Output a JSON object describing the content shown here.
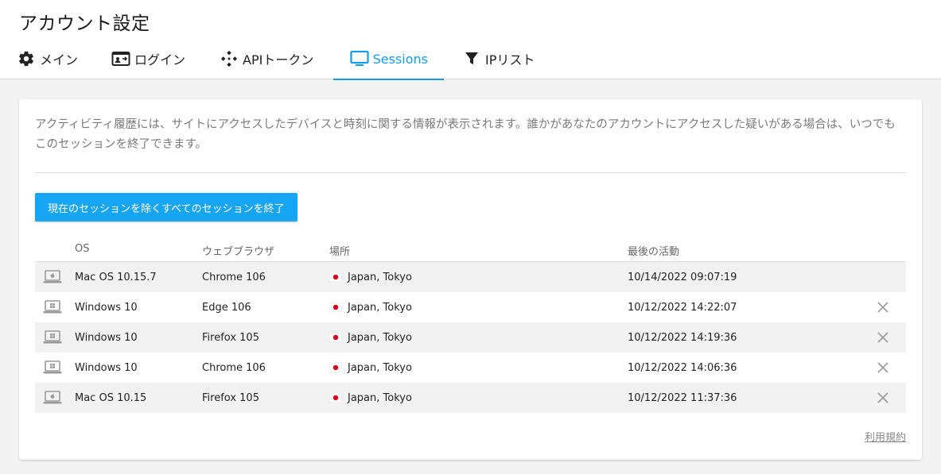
{
  "page": {
    "title": "アカウント設定"
  },
  "tabs": [
    {
      "label": "メイン",
      "icon": "gear-icon"
    },
    {
      "label": "ログイン",
      "icon": "id-card-icon"
    },
    {
      "label": "APIトークン",
      "icon": "api-icon"
    },
    {
      "label": "Sessions",
      "icon": "monitor-icon",
      "active": true
    },
    {
      "label": "IPリスト",
      "icon": "filter-icon"
    }
  ],
  "colors": {
    "accent": "#1a9ae6",
    "button": "#16a5f2",
    "row_shade": "#f2f2f2"
  },
  "sessions": {
    "description": "アクティビティ履歴には、サイトにアクセスしたデバイスと時刻に関する情報が表示されます。誰かがあなたのアカウントにアクセスした疑いがある場合は、いつでもこのセッションを終了できます。",
    "end_all_label": "現在のセッションを除くすべてのセッションを終了",
    "columns": {
      "os": "OS",
      "browser": "ウェブブラウザ",
      "location": "場所",
      "last_activity": "最後の活動"
    },
    "rows": [
      {
        "device_icon": "apple-laptop-icon",
        "os": "Mac OS 10.15.7",
        "browser": "Chrome 106",
        "location": "Japan, Tokyo",
        "last_activity": "10/14/2022 09:07:19",
        "closable": false
      },
      {
        "device_icon": "windows-laptop-icon",
        "os": "Windows 10",
        "browser": "Edge 106",
        "location": "Japan, Tokyo",
        "last_activity": "10/12/2022 14:22:07",
        "closable": true
      },
      {
        "device_icon": "windows-laptop-icon",
        "os": "Windows 10",
        "browser": "Firefox 105",
        "location": "Japan, Tokyo",
        "last_activity": "10/12/2022 14:19:36",
        "closable": true
      },
      {
        "device_icon": "windows-laptop-icon",
        "os": "Windows 10",
        "browser": "Chrome 106",
        "location": "Japan, Tokyo",
        "last_activity": "10/12/2022 14:06:36",
        "closable": true
      },
      {
        "device_icon": "apple-laptop-icon",
        "os": "Mac OS 10.15",
        "browser": "Firefox 105",
        "location": "Japan, Tokyo",
        "last_activity": "10/12/2022 11:37:36",
        "closable": true
      }
    ],
    "terms_link": "利用規約"
  }
}
